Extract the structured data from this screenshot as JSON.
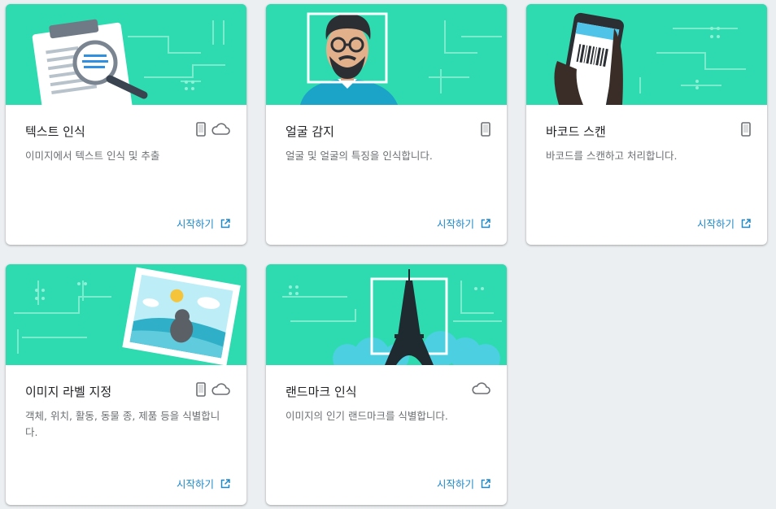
{
  "cards": [
    {
      "title": "텍스트 인식",
      "description": "이미지에서 텍스트 인식 및 추출",
      "platform_icons": [
        "phone-icon",
        "cloud-icon"
      ],
      "link_label": "시작하기"
    },
    {
      "title": "얼굴 감지",
      "description": "얼굴 및 얼굴의 특징을 인식합니다.",
      "platform_icons": [
        "phone-icon"
      ],
      "link_label": "시작하기"
    },
    {
      "title": "바코드 스캔",
      "description": "바코드를 스캔하고 처리합니다.",
      "platform_icons": [
        "phone-icon"
      ],
      "link_label": "시작하기"
    },
    {
      "title": "이미지 라벨 지정",
      "description": "객체, 위치, 활동, 동물 종, 제품 등을 식별합니다.",
      "platform_icons": [
        "phone-icon",
        "cloud-icon"
      ],
      "link_label": "시작하기"
    },
    {
      "title": "랜드마크 인식",
      "description": "이미지의 인기 랜드마크를 식별합니다.",
      "platform_icons": [
        "cloud-icon"
      ],
      "link_label": "시작하기"
    }
  ],
  "colors": {
    "hero_background": "#2edbb0",
    "link": "#1e88c8",
    "page_background": "#eceff1"
  }
}
